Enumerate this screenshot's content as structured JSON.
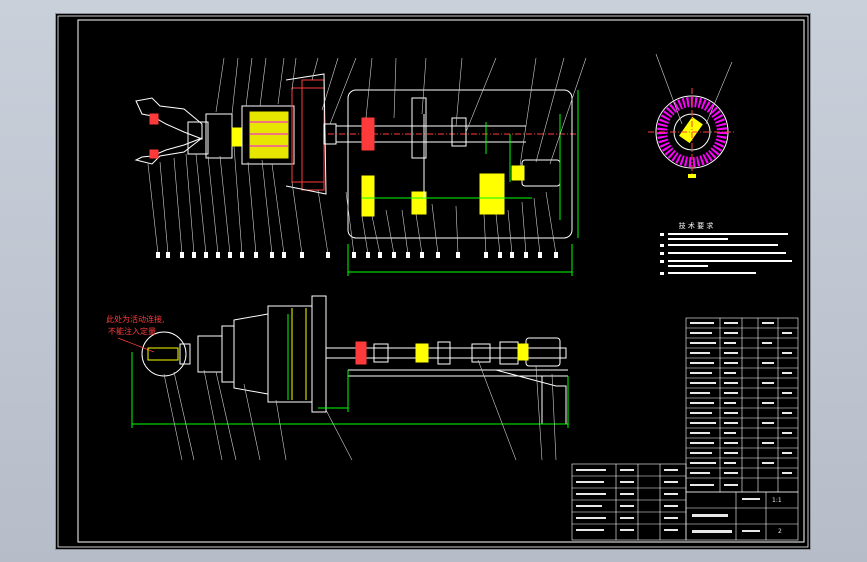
{
  "annotation": {
    "line1": "此处为活动连接,",
    "line2": "不能注入定量"
  },
  "tech_requirements_title": "技 术 要 求",
  "title_block": {
    "drawing_no": "2",
    "scale_label": "1:1"
  },
  "colors": {
    "background": "#000000",
    "outline": "#ffffff",
    "dimension": "#00ff00",
    "part": "#ffff00",
    "hatch": "#ff00ff",
    "centerline": "#ff3a3a",
    "leader": "#cfcfcf"
  }
}
